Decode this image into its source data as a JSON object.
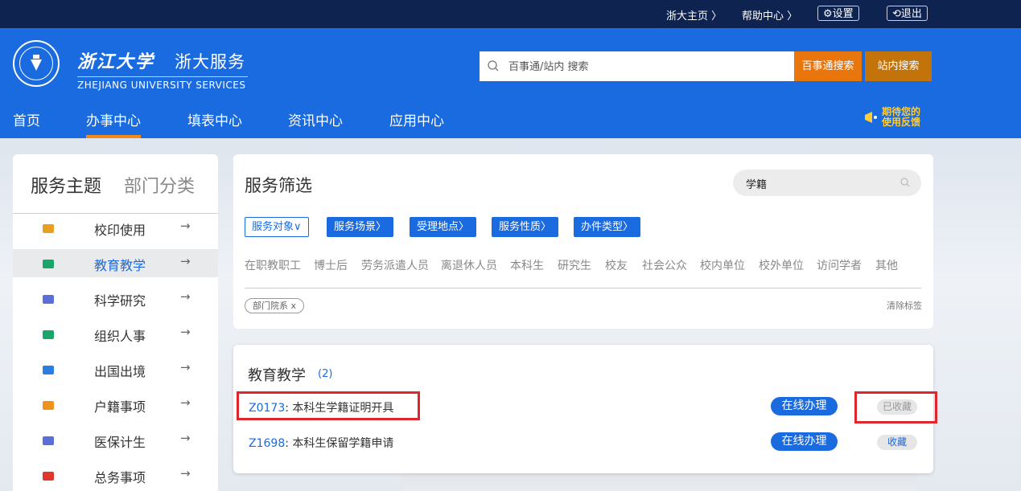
{
  "topbar": {
    "home_link": "浙大主页",
    "help_link": "帮助中心",
    "settings": "设置",
    "logout": "退出"
  },
  "header": {
    "logo_cn": "浙江大学",
    "logo_service": "浙大服务",
    "logo_en": "ZHEJIANG UNIVERSITY SERVICES",
    "search_placeholder": "百事通/站内 搜索",
    "btn_baishitong": "百事通搜索",
    "btn_site": "站内搜索",
    "feedback_line1": "期待您的",
    "feedback_line2": "使用反馈"
  },
  "nav": {
    "items": [
      "首页",
      "办事中心",
      "填表中心",
      "资讯中心",
      "应用中心"
    ],
    "active": "办事中心"
  },
  "left_panel": {
    "tab_active": "服务主题",
    "tab_inactive": "部门分类",
    "items": [
      {
        "label": "校印使用",
        "icon": "bank-icon",
        "color": "#e8a020"
      },
      {
        "label": "教育教学",
        "icon": "books-icon",
        "color": "#1aa56a"
      },
      {
        "label": "科学研究",
        "icon": "flask-icon",
        "color": "#5b6fd6"
      },
      {
        "label": "组织人事",
        "icon": "folder-icon",
        "color": "#1aa56a"
      },
      {
        "label": "出国出境",
        "icon": "id-card-icon",
        "color": "#2b7de0"
      },
      {
        "label": "户籍事项",
        "icon": "calendar-icon",
        "color": "#f0921a"
      },
      {
        "label": "医保计生",
        "icon": "medkit-icon",
        "color": "#5b6fd6"
      },
      {
        "label": "总务事项",
        "icon": "ticket-icon",
        "color": "#e0362c"
      }
    ],
    "active_index": 1,
    "arrow": "→"
  },
  "filter_panel": {
    "title": "服务筛选",
    "search_value": "学籍",
    "chips": [
      "服务对象",
      "服务场景",
      "受理地点",
      "服务性质",
      "办件类型"
    ],
    "options": [
      "在职教职工",
      "博士后",
      "劳务派遣人员",
      "离退休人员",
      "本科生",
      "研究生",
      "校友",
      "社会公众",
      "校内单位",
      "校外单位",
      "访问学者",
      "其他"
    ],
    "tag": "部门院系 x",
    "clear_label": "清除标签"
  },
  "results": {
    "title": "教育教学",
    "count": "(2)",
    "rows": [
      {
        "code": "Z0173",
        "name": ": 本科生学籍证明开具",
        "action": "在线办理",
        "fav": "已收藏",
        "fav_color": "#999999"
      },
      {
        "code": "Z1698",
        "name": ": 本科生保留学籍申请",
        "action": "在线办理",
        "fav": "收藏",
        "fav_color": "#1a6ae0"
      }
    ]
  },
  "colors": {
    "brand_blue": "#1a6ae0",
    "topbar_navy": "#0e2350",
    "orange": "#e8760c",
    "highlight_red": "#e0262c"
  }
}
